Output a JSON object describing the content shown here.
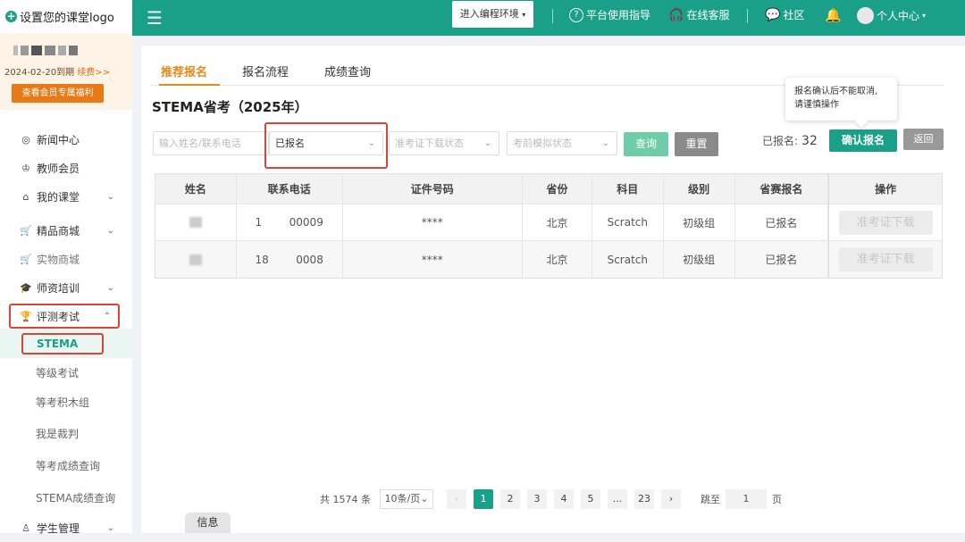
{
  "sidebar": {
    "logo_text": "设置您的课堂logo",
    "member": {
      "expire_date": "2024-02-20到期",
      "renew": "续费>>",
      "benefit_button": "查看会员专属福利"
    },
    "nav": [
      {
        "label": "新闻中心",
        "icon": "compass-icon"
      },
      {
        "label": "教师会员",
        "icon": "crown-icon"
      },
      {
        "label": "我的课堂",
        "icon": "home-icon",
        "chevron": "⌄"
      },
      {
        "label": "精品商城",
        "icon": "cart-icon",
        "chevron": "⌄"
      },
      {
        "label": "实物商城",
        "icon": "cart-icon"
      },
      {
        "label": "师资培训",
        "icon": "graduation-cap-icon",
        "chevron": "⌄"
      },
      {
        "label": "评测考试",
        "icon": "trophy-icon",
        "chevron": "⌃"
      }
    ],
    "sub_items": [
      "STEMA",
      "等级考试",
      "等考积木组",
      "我是裁判",
      "等考成绩查询",
      "STEMA成绩查询"
    ],
    "bottom_item": {
      "label": "学生管理",
      "icon": "student-icon",
      "chevron": "⌄"
    }
  },
  "topbar": {
    "env_button": "进入编程环境",
    "guide": "平台使用指导",
    "service": "在线客服",
    "community": "社区",
    "user": "个人中心"
  },
  "tabs": [
    "推荐报名",
    "报名流程",
    "成绩查询"
  ],
  "page_title": "STEMA省考（2025年）",
  "filters": {
    "name_placeholder": "输入姓名/联系电话",
    "signup_status": "已报名",
    "ticket_placeholder": "准考证下载状态",
    "mock_placeholder": "考前模拟状态"
  },
  "buttons": {
    "query": "查询",
    "reset": "重置",
    "confirm": "确认报名",
    "back": "返回"
  },
  "signed_count": {
    "label": "已报名:",
    "value": "32"
  },
  "tooltip": {
    "line1": "报名确认后不能取消,",
    "line2": "请谨慎操作"
  },
  "table": {
    "headers": [
      "姓名",
      "联系电话",
      "证件号码",
      "省份",
      "科目",
      "级别",
      "省赛报名",
      "操作"
    ],
    "rows": [
      {
        "phone": "1        00009",
        "id": "****",
        "province": "北京",
        "subject": "Scratch",
        "level": "初级组",
        "status": "已报名",
        "action": "准考证下载"
      },
      {
        "phone": "18        0008",
        "id": "****",
        "province": "北京",
        "subject": "Scratch",
        "level": "初级组",
        "status": "已报名",
        "action": "准考证下载"
      }
    ]
  },
  "pagination": {
    "total": "共 1574 条",
    "page_size": "10条/页",
    "pages": [
      "1",
      "2",
      "3",
      "4",
      "5",
      "...",
      "23"
    ],
    "current": "1",
    "jump_label": "跳至",
    "jump_value": "1",
    "page_unit": "页"
  },
  "info_tab": "信息",
  "colors": {
    "brand": "#1aa088",
    "accent": "#e68a1a",
    "highlight": "#d9453b"
  }
}
